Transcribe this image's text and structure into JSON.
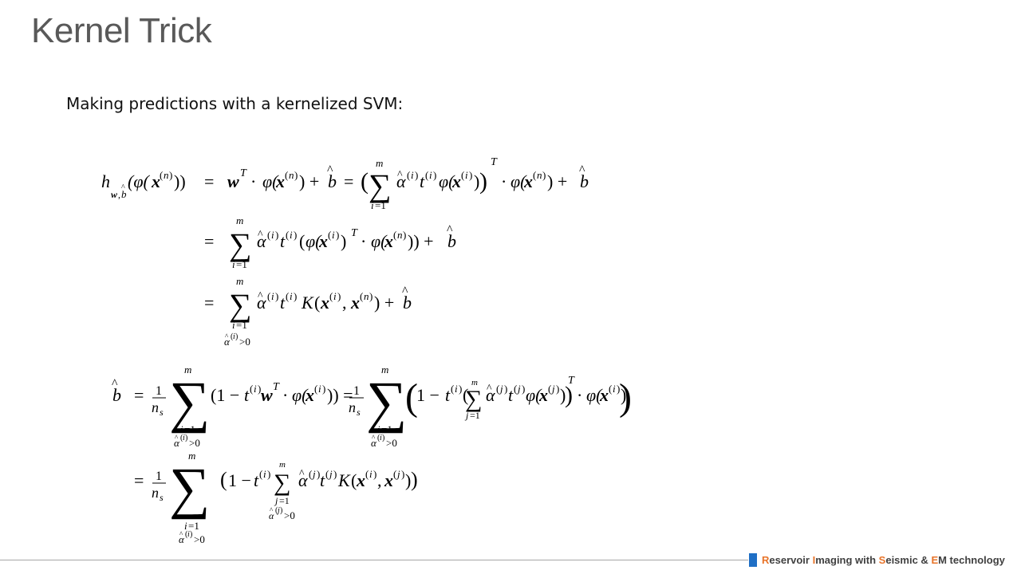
{
  "slide": {
    "title": "Kernel Trick",
    "subtitle": "Making predictions with a kernelized SVM:"
  },
  "footer": {
    "segments": [
      {
        "text": "R",
        "highlight": true
      },
      {
        "text": "eservoir ",
        "highlight": false
      },
      {
        "text": "I",
        "highlight": true
      },
      {
        "text": "maging with ",
        "highlight": false
      },
      {
        "text": "S",
        "highlight": true
      },
      {
        "text": "eismic & ",
        "highlight": false
      },
      {
        "text": "E",
        "highlight": true
      },
      {
        "text": "M technology",
        "highlight": false
      }
    ],
    "accent_color": "#e8742a",
    "mark_color": "#1f6fc5"
  },
  "equations": {
    "prediction": {
      "lines": [
        "h_{w,b̂}(φ(x^(n))) = w^T · φ(x^(n)) + b̂ = (Σ_{i=1}^{m} α̂^(i) t^(i) φ(x^(i)))^T · φ(x^(n)) + b̂",
        "= Σ_{i=1}^{m} α̂^(i) t^(i) (φ(x^(i))^T · φ(x^(n))) + b̂",
        "= Σ_{i=1, α̂^(i)>0}^{m} α̂^(i) t^(i) K(x^(i), x^(n)) + b̂"
      ]
    },
    "bias": {
      "lines": [
        "b̂ = 1/n_s Σ_{i=1, α̂^(i)>0}^{m} (1 − t^(i) w^T · φ(x^(i))) = 1/n_s Σ_{i=1, α̂^(i)>0}^{m} (1 − t^(i) (Σ_{j=1}^{m} α̂^(j) t^(j) φ(x^(j)))^T · φ(x^(i)))",
        "= 1/n_s Σ_{i=1, α̂^(i)>0}^{m} (1 − t^(i) Σ_{j=1, α̂^(j)>0}^{m} α̂^(j) t^(j) K(x^(i), x^(j)))"
      ]
    }
  }
}
